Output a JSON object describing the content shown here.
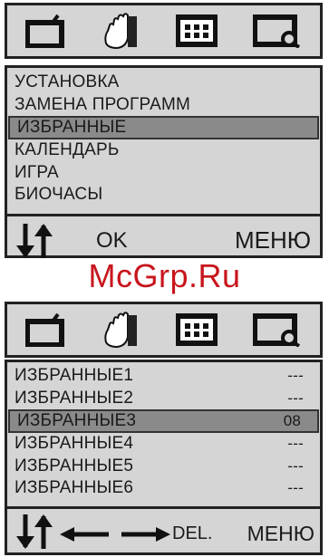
{
  "screen1": {
    "icons": [
      "tv-icon",
      "hand-icon",
      "calendar-icon",
      "clock-icon"
    ],
    "items": [
      {
        "label": "УСТАНОВКА"
      },
      {
        "label": "ЗАМЕНА ПРОГРАММ"
      },
      {
        "label": "ИЗБРАННЫЕ",
        "selected": true
      },
      {
        "label": "КАЛЕНДАРЬ"
      },
      {
        "label": "ИГРА"
      },
      {
        "label": "БИОЧАСЫ"
      }
    ],
    "footer": {
      "ok": "OK",
      "menu": "МЕНЮ"
    }
  },
  "watermark": "McGrp.Ru",
  "screen2": {
    "icons": [
      "tv-icon",
      "hand-icon",
      "calendar-icon",
      "clock-icon"
    ],
    "items": [
      {
        "label": "ИЗБРАННЫЕ1",
        "value": "---"
      },
      {
        "label": "ИЗБРАННЫЕ2",
        "value": "---"
      },
      {
        "label": "ИЗБРАННЫЕ3",
        "value": "08",
        "selected": true
      },
      {
        "label": "ИЗБРАННЫЕ4",
        "value": "---"
      },
      {
        "label": "ИЗБРАННЫЕ5",
        "value": "---"
      },
      {
        "label": "ИЗБРАННЫЕ6",
        "value": "---"
      }
    ],
    "footer": {
      "del": "DEL.",
      "menu": "МЕНЮ"
    }
  },
  "colors": {
    "panel": "#d5d5d5",
    "selection": "#8a8a8a",
    "watermark": "#c8151d"
  }
}
